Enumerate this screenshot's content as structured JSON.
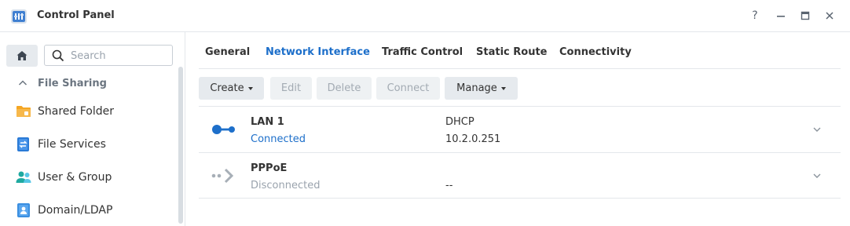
{
  "window": {
    "title": "Control Panel",
    "controls": {
      "help": "?",
      "minimize": "–",
      "maximize": "□",
      "close": "×"
    }
  },
  "sidebar": {
    "search": {
      "placeholder": "Search",
      "value": ""
    },
    "section": {
      "label": "File Sharing",
      "state": "expanded"
    },
    "items": [
      {
        "label": "Shared Folder",
        "icon": "folder-icon",
        "color": "#f5a623"
      },
      {
        "label": "File Services",
        "icon": "file-services-icon",
        "color": "#2a7ad6"
      },
      {
        "label": "User & Group",
        "icon": "user-group-icon",
        "color": "#1fa9a0"
      },
      {
        "label": "Domain/LDAP",
        "icon": "domain-ldap-icon",
        "color": "#3b8fe0"
      }
    ]
  },
  "tabs": [
    {
      "label": "General",
      "active": false
    },
    {
      "label": "Network Interface",
      "active": true
    },
    {
      "label": "Traffic Control",
      "active": false
    },
    {
      "label": "Static Route",
      "active": false
    },
    {
      "label": "Connectivity",
      "active": false
    }
  ],
  "toolbar": {
    "create": "Create",
    "edit": "Edit",
    "delete": "Delete",
    "connect": "Connect",
    "manage": "Manage"
  },
  "interfaces": [
    {
      "name": "LAN 1",
      "status": "Connected",
      "mode": "DHCP",
      "address": "10.2.0.251",
      "icon": "lan-connected-icon"
    },
    {
      "name": "PPPoE",
      "status": "Disconnected",
      "mode": "",
      "address": "--",
      "icon": "pppoe-disconnected-icon"
    }
  ],
  "colors": {
    "accent": "#1d6fca",
    "button_bg": "#e6eaee",
    "disabled_text": "#a3abb3"
  }
}
